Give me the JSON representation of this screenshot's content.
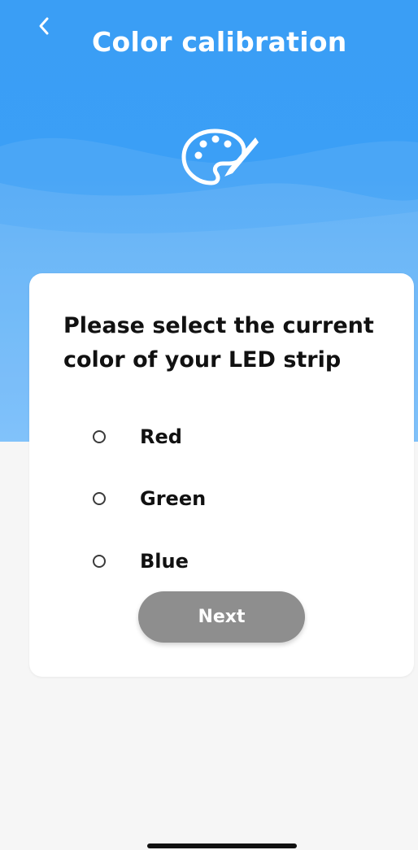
{
  "header": {
    "title": "Color calibration",
    "back_icon": "chevron-left-icon",
    "hero_icon": "palette-icon"
  },
  "card": {
    "question": "Please select the current color of your LED strip",
    "options": [
      {
        "label": "Red",
        "selected": false
      },
      {
        "label": "Green",
        "selected": false
      },
      {
        "label": "Blue",
        "selected": false
      }
    ],
    "next_label": "Next",
    "next_enabled": false
  },
  "colors": {
    "header_blue": "#3a9ef5",
    "card_background": "#ffffff",
    "page_background": "#f6f6f6",
    "button_disabled": "#8e8e8e",
    "text_primary": "#111111"
  }
}
